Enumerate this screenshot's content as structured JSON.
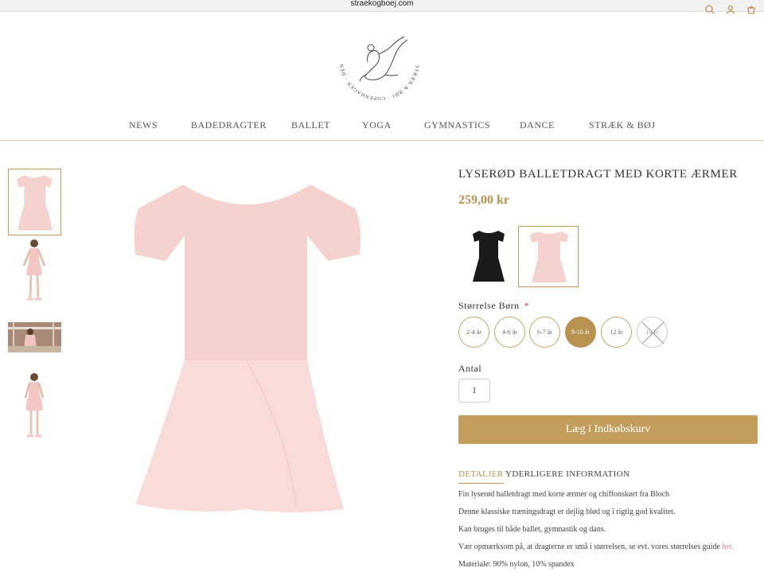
{
  "browser": {
    "url": "straekogboej.com"
  },
  "logo": {
    "ring_text": "STRÆK & BØJ · COPENHAGEN · DENMARK · ESTABLISHED 1983"
  },
  "nav": {
    "items": [
      "NEWS",
      "BADEDRAGTER",
      "BALLET",
      "YOGA",
      "GYMNASTICS",
      "DANCE",
      "STRÆK & BØJ"
    ]
  },
  "product": {
    "title": "LYSERØD BALLETDRAGT MED KORTE ÆRMER",
    "price": "259,00 kr",
    "size_label": "Størrelse Børn",
    "required_mark": "*",
    "sizes": [
      {
        "label": "2-4 år",
        "state": "normal"
      },
      {
        "label": "4-6 år",
        "state": "normal"
      },
      {
        "label": "6-7 år",
        "state": "normal"
      },
      {
        "label": "8-10 år",
        "state": "selected"
      },
      {
        "label": "12 år",
        "state": "normal"
      },
      {
        "label": "14 år",
        "state": "disabled"
      }
    ],
    "qty_label": "Antal",
    "qty_value": "1",
    "cart_button": "Læg i Indkøbskurv",
    "tabs": [
      "DETALJER",
      "YDERLIGERE INFORMATION"
    ],
    "details": {
      "line1": "Fin lyserød balletdragt med korte ærmer og chiffonskørt fra Bloch",
      "line2": "Denne klassiske træningsdragt er dejlig blød og i rigtig god kvalitet.",
      "line3": "Kan bruges til både ballet, gymnastik og dans.",
      "line4": "Vær opmærksom på, at dragterne er små i størrelsen, se evt. vores størrelses guide",
      "line4_link": "her.",
      "line5": "Materiale: 90% nylon, 10% spandex"
    }
  },
  "colors": {
    "accent": "#b8924f",
    "button": "#c39d5c",
    "pink": "#f6d2cf",
    "black": "#1a1a1a"
  }
}
